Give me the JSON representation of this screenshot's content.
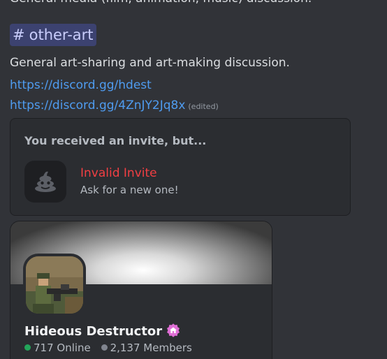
{
  "message": {
    "top_line": "General media (film, animation, music) discussion.",
    "channel_mention": {
      "hash": "#",
      "name": "other-art"
    },
    "description": "General art-sharing and art-making discussion.",
    "links": [
      {
        "text": "https://discord.gg/hdest"
      },
      {
        "text": "https://discord.gg/4ZnJY2Jq8x",
        "edited_label": "(edited)"
      }
    ]
  },
  "invalid_invite": {
    "header": "You received an invite, but...",
    "icon": "poop-icon",
    "title": "Invalid Invite",
    "subtitle": "Ask for a new one!",
    "title_color": "#f23f43"
  },
  "server_invite": {
    "name": "Hideous Destructor",
    "badge_icon": "server-home-badge-icon",
    "online": "717 Online",
    "members": "2,137 Members",
    "online_color": "#23a55a"
  },
  "colors": {
    "background": "#313338",
    "card": "#2b2d31",
    "link": "#4f9cf0",
    "mention_bg": "#3c4270"
  }
}
